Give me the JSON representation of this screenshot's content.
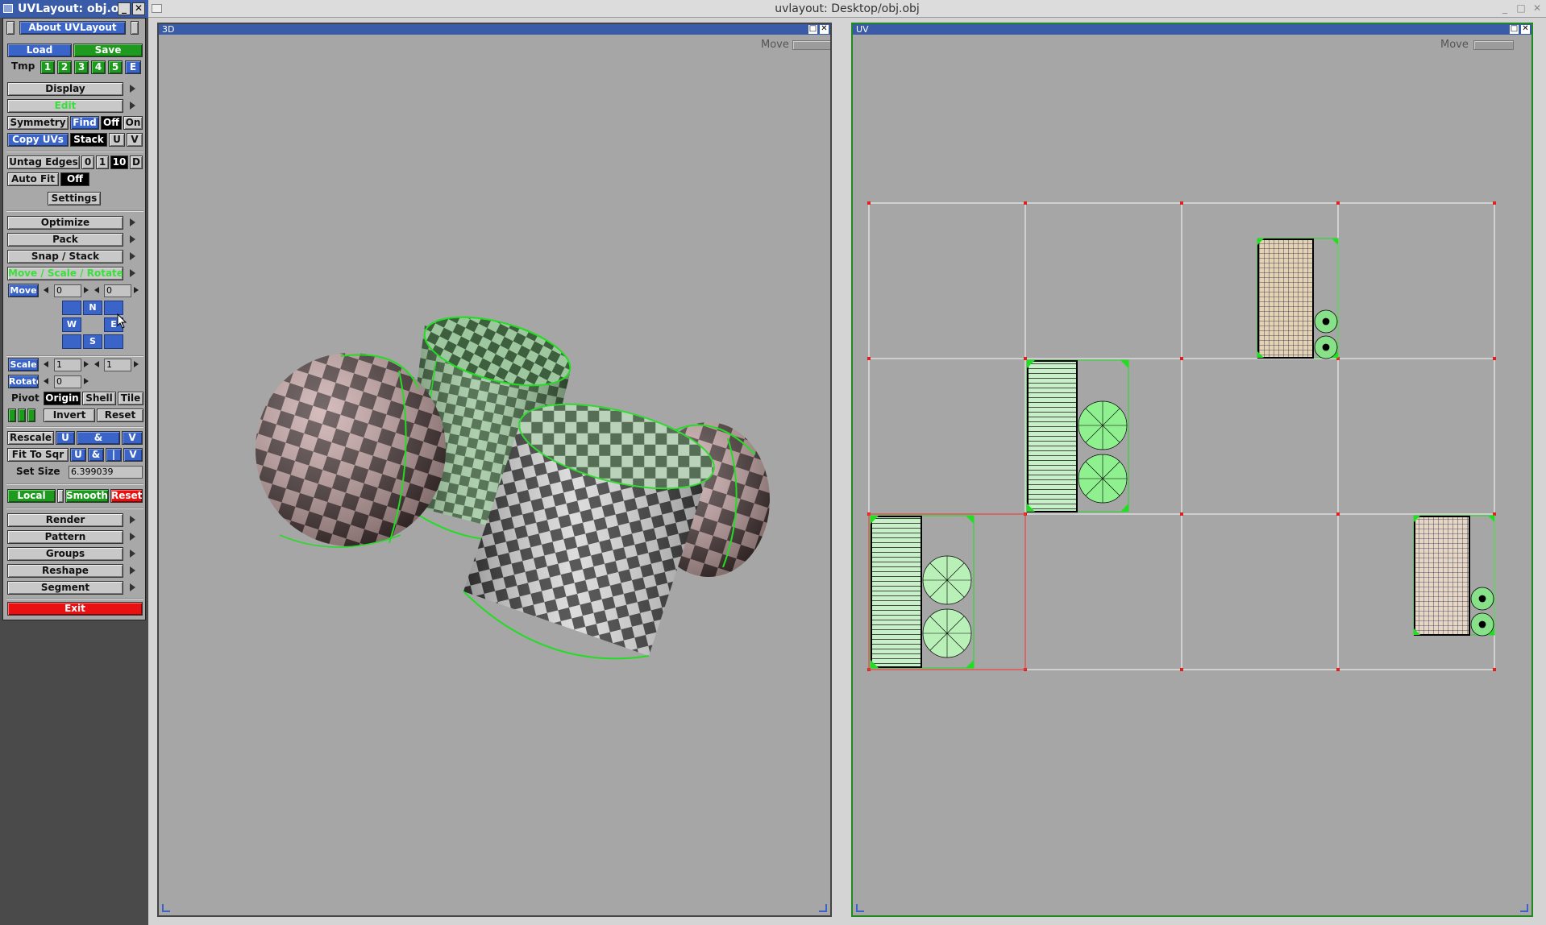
{
  "tool_window": {
    "title": "UVLayout: obj.obj",
    "about": "About UVLayout",
    "load": "Load",
    "save": "Save",
    "tmp": "Tmp",
    "tmp_slots": [
      "1",
      "2",
      "3",
      "4",
      "5",
      "E"
    ],
    "display": "Display",
    "edit": "Edit",
    "symmetry": "Symmetry",
    "find": "Find",
    "off": "Off",
    "on": "On",
    "copy_uvs": "Copy UVs",
    "stack": "Stack",
    "u": "U",
    "v": "V",
    "untag_edges": "Untag Edges",
    "untag_opts": [
      "0",
      "1",
      "10",
      "D"
    ],
    "auto_fit": "Auto Fit",
    "auto_fit_value": "Off",
    "settings": "Settings",
    "optimize": "Optimize",
    "pack": "Pack",
    "snap_stack": "Snap / Stack",
    "move_scale_rotate": "Move / Scale / Rotate",
    "move": "Move",
    "move_x": "0",
    "move_y": "0",
    "compass_n": "N",
    "compass_w": "W",
    "compass_e": "E",
    "compass_s": "S",
    "scale": "Scale",
    "scale_x": "1",
    "scale_y": "1",
    "rotate": "Rotate",
    "rotate_value": "0",
    "pivot": "Pivot",
    "origin": "Origin",
    "shell": "Shell",
    "tile": "Tile",
    "invert": "Invert",
    "reset": "Reset",
    "rescale": "Rescale",
    "amp": "&",
    "fit_to_sqr": "Fit To Sqr",
    "bar": "|",
    "set_size": "Set Size",
    "set_size_value": "6.399039",
    "local": "Local",
    "smooth": "Smooth",
    "reset_red": "Reset",
    "render": "Render",
    "pattern": "Pattern",
    "groups": "Groups",
    "reshape": "Reshape",
    "segment": "Segment",
    "exit": "Exit"
  },
  "main_window": {
    "title": "uvlayout: Desktop/obj.obj",
    "viewport_3d": {
      "label": "3D",
      "move_label": "Move"
    },
    "viewport_uv": {
      "label": "UV",
      "move_label": "Move"
    }
  },
  "colors": {
    "accent": "#3a64c8",
    "shell_outline": "#22dd22",
    "grid_marker": "#e02020"
  },
  "icons": [
    "window-icon",
    "minimize-icon",
    "close-icon",
    "maximize-icon",
    "submenu-arrow-icon",
    "mouse-cursor-icon"
  ]
}
